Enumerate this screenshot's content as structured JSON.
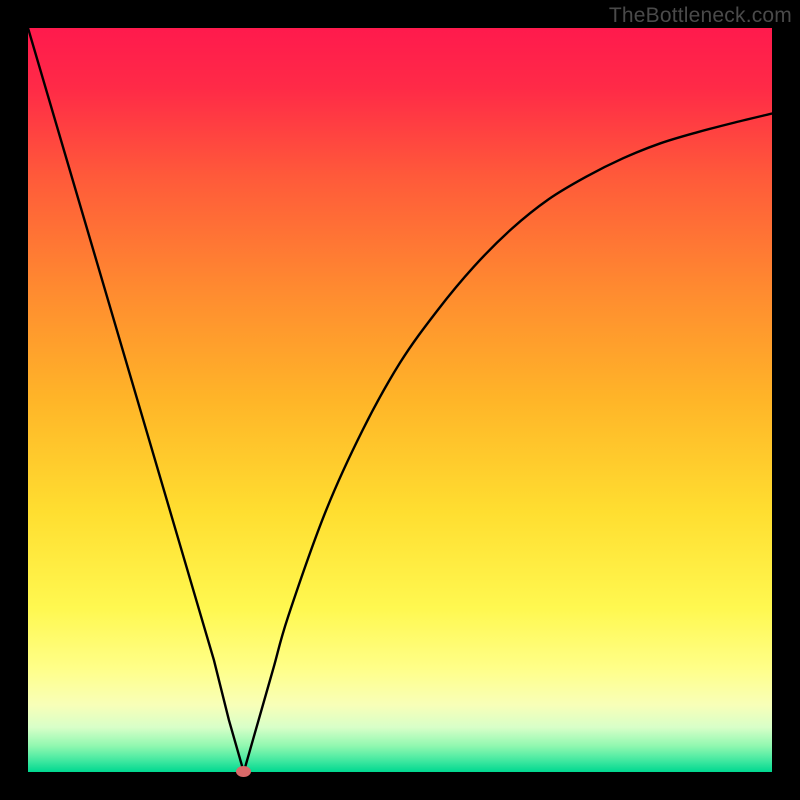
{
  "watermark": "TheBottleneck.com",
  "gradient": {
    "stops": [
      {
        "offset": 0.0,
        "color": "#ff1a4d"
      },
      {
        "offset": 0.08,
        "color": "#ff2a47"
      },
      {
        "offset": 0.2,
        "color": "#ff5a3a"
      },
      {
        "offset": 0.35,
        "color": "#ff8a30"
      },
      {
        "offset": 0.5,
        "color": "#ffb528"
      },
      {
        "offset": 0.65,
        "color": "#ffde30"
      },
      {
        "offset": 0.78,
        "color": "#fff850"
      },
      {
        "offset": 0.86,
        "color": "#ffff88"
      },
      {
        "offset": 0.91,
        "color": "#f8ffb8"
      },
      {
        "offset": 0.94,
        "color": "#d8ffc8"
      },
      {
        "offset": 0.965,
        "color": "#90f8b0"
      },
      {
        "offset": 0.985,
        "color": "#40e8a0"
      },
      {
        "offset": 1.0,
        "color": "#00d890"
      }
    ]
  },
  "chart_data": {
    "type": "line",
    "title": "",
    "xlabel": "",
    "ylabel": "",
    "xlim": [
      0,
      100
    ],
    "ylim": [
      0,
      100
    ],
    "x_min_at": 29,
    "marker": {
      "x": 29,
      "y": 0
    },
    "series": [
      {
        "name": "curve",
        "x": [
          0,
          5,
          10,
          15,
          20,
          25,
          27,
          29,
          31,
          33,
          35,
          40,
          45,
          50,
          55,
          60,
          65,
          70,
          75,
          80,
          85,
          90,
          95,
          100
        ],
        "y": [
          100,
          83,
          66,
          49,
          32,
          15,
          7,
          0,
          7,
          14,
          21,
          35,
          46,
          55,
          62,
          68,
          73,
          77,
          80,
          82.5,
          84.5,
          86,
          87.3,
          88.5
        ]
      }
    ]
  }
}
